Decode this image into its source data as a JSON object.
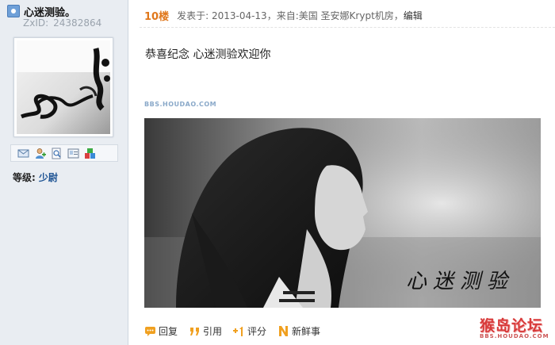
{
  "user": {
    "name": "心迷测验。",
    "zxid_label": "ZxID:",
    "zxid_value": "24382864",
    "rank_label": "等级:",
    "rank_value": "少尉",
    "actions": [
      "message-icon",
      "add-friend-icon",
      "search-posts-icon",
      "profile-card-icon",
      "gift-blocks-icon"
    ]
  },
  "post": {
    "floor": "10楼",
    "posted_at": "发表于: 2013-04-13，来自:美国 圣安娜Krypt机房，",
    "edit_label": "编辑",
    "content": "恭喜纪念  心迷测验欢迎你",
    "image_watermark": "BBS.HOUDAO.COM",
    "image_signature": "心迷测验"
  },
  "footer": {
    "reply": "回复",
    "quote": "引用",
    "rate": "评分",
    "fresh": "新鲜事"
  },
  "site_logo": {
    "main": "猴岛论坛",
    "sub": "BBS.HOUDAO.COM"
  },
  "colors": {
    "sidebar_bg": "#e9edf2",
    "floor": "#e0771b",
    "rank_link": "#1e5494",
    "logo": "#d83a3a"
  }
}
